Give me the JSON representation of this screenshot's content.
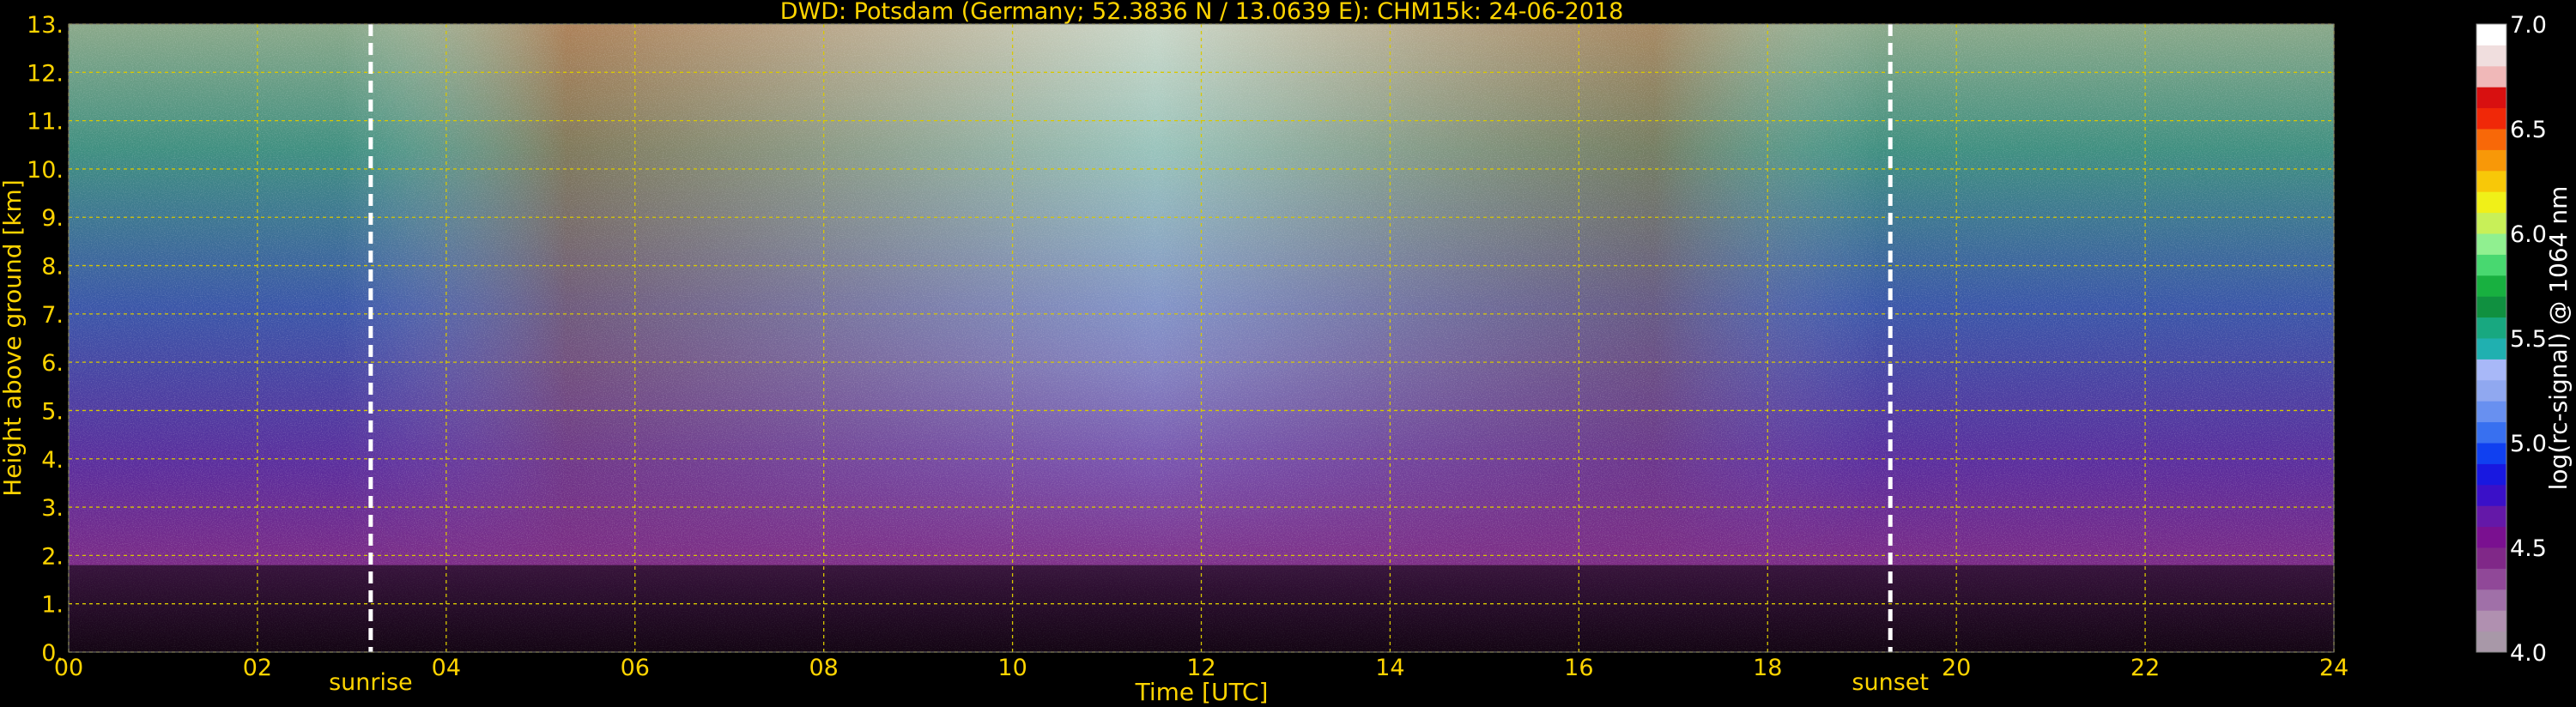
{
  "chart_data": {
    "type": "heatmap",
    "title": "DWD: Potsdam (Germany; 52.3836 N / 13.0639 E):    CHM15k: 24-06-2018",
    "xlabel": "Time [UTC]",
    "ylabel": "Height above ground [km]",
    "xlim": [
      0,
      24
    ],
    "ylim": [
      0,
      13
    ],
    "x_ticks": [
      "00",
      "02",
      "04",
      "06",
      "08",
      "10",
      "12",
      "14",
      "16",
      "18",
      "20",
      "22",
      "24"
    ],
    "y_ticks": [
      "0.",
      "1.",
      "2.",
      "3.",
      "4.",
      "5.",
      "6.",
      "7.",
      "8.",
      "9.",
      "10.",
      "11.",
      "12.",
      "13."
    ],
    "grid": true,
    "events": [
      {
        "label": "sunrise",
        "time": 3.2
      },
      {
        "label": "sunset",
        "time": 19.3
      }
    ],
    "colorbar": {
      "label": "log(rc-signal) @ 1064 nm",
      "range": [
        4.0,
        7.0
      ],
      "ticks": [
        "4.0",
        "4.5",
        "5.0",
        "5.5",
        "6.0",
        "6.5",
        "7.0"
      ],
      "levels": 30
    }
  },
  "colors": {
    "text": "#ffd400",
    "grid": "#d8c800",
    "event_line": "#ffffff",
    "background": "#000000"
  }
}
